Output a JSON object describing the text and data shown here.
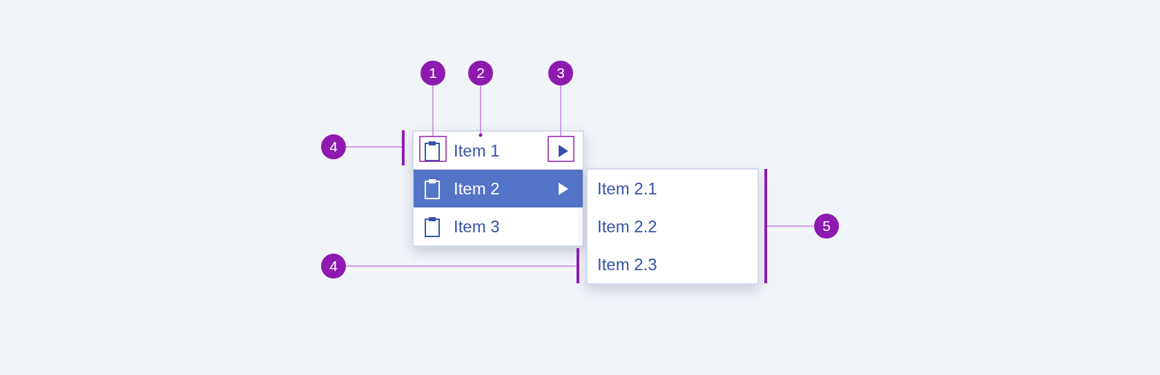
{
  "menu": {
    "items": [
      {
        "label": "Item 1",
        "selected": false,
        "has_submenu": true
      },
      {
        "label": "Item 2",
        "selected": true,
        "has_submenu": true
      },
      {
        "label": "Item 3",
        "selected": false,
        "has_submenu": false
      }
    ]
  },
  "submenu": {
    "items": [
      {
        "label": "Item 2.1"
      },
      {
        "label": "Item 2.2"
      },
      {
        "label": "Item 2.3"
      }
    ]
  },
  "callouts": [
    {
      "label": "1"
    },
    {
      "label": "2"
    },
    {
      "label": "3"
    },
    {
      "label": "4"
    },
    {
      "label": "4"
    },
    {
      "label": "5"
    }
  ]
}
